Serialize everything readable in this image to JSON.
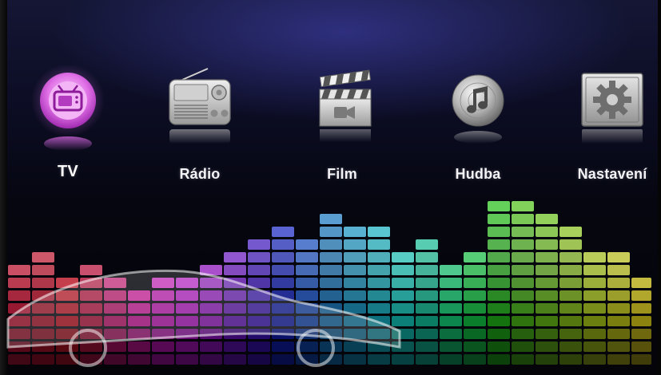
{
  "menu": {
    "items": [
      {
        "id": "tv",
        "label": "TV",
        "icon": "tv-icon",
        "selected": true
      },
      {
        "id": "radio",
        "label": "Rádio",
        "icon": "radio-icon",
        "selected": false
      },
      {
        "id": "film",
        "label": "Film",
        "icon": "film-clapper-icon",
        "selected": false
      },
      {
        "id": "music",
        "label": "Hudba",
        "icon": "music-disc-icon",
        "selected": false
      },
      {
        "id": "settings",
        "label": "Nastavení",
        "icon": "settings-gear-icon",
        "selected": false
      }
    ]
  },
  "colors": {
    "selected_accent": "#e070e6",
    "label": "#f4f4f8",
    "background_top": "#141634",
    "background_bottom": "#040409"
  }
}
